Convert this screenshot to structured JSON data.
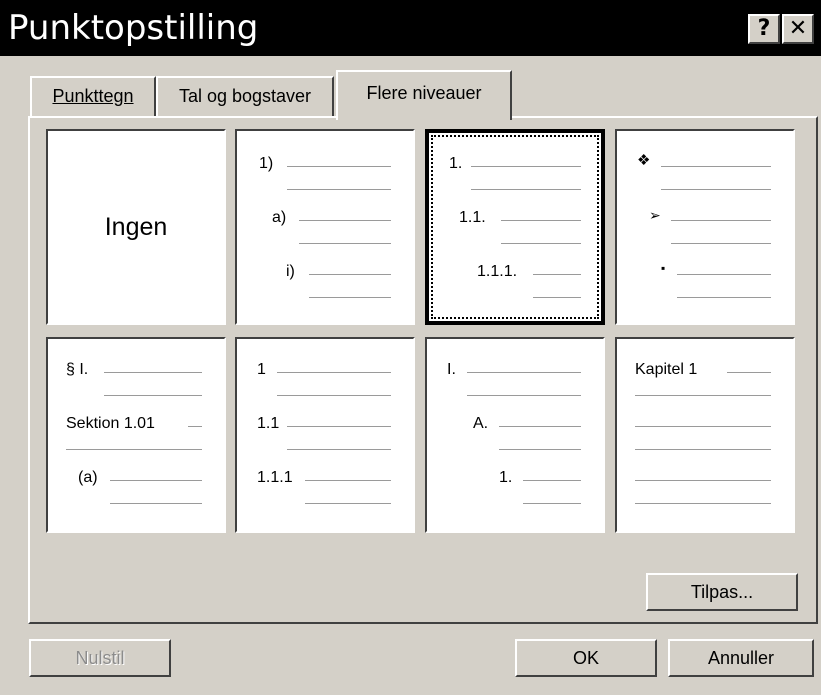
{
  "window": {
    "title": "Punktopstilling",
    "help_label": "?",
    "close_label": "✕"
  },
  "tabs": [
    {
      "label": "Punkttegn",
      "active": false
    },
    {
      "label": "Tal og bogstaver",
      "active": false
    },
    {
      "label": "Flere niveauer",
      "active": true
    }
  ],
  "options": [
    {
      "name": "none",
      "text": "Ingen",
      "levels": []
    },
    {
      "name": "paren-number-letter-roman",
      "levels": [
        "1)",
        "a)",
        "i)"
      ]
    },
    {
      "name": "decimal-outline",
      "selected": true,
      "levels": [
        "1.",
        "1.1.",
        "1.1.1."
      ]
    },
    {
      "name": "bullet-symbols",
      "levels": [
        "❖",
        "➢",
        "▪"
      ]
    },
    {
      "name": "section-article",
      "levels": [
        "§ I.",
        "Sektion 1.01",
        "(a)"
      ]
    },
    {
      "name": "legal-numbers",
      "levels": [
        "1",
        "1.1",
        "1.1.1"
      ]
    },
    {
      "name": "roman-letter-number",
      "levels": [
        "I.",
        "A.",
        "1."
      ]
    },
    {
      "name": "chapter",
      "levels": [
        "Kapitel 1"
      ]
    }
  ],
  "buttons": {
    "customize": "Tilpas...",
    "reset": "Nulstil",
    "ok": "OK",
    "cancel": "Annuller"
  }
}
